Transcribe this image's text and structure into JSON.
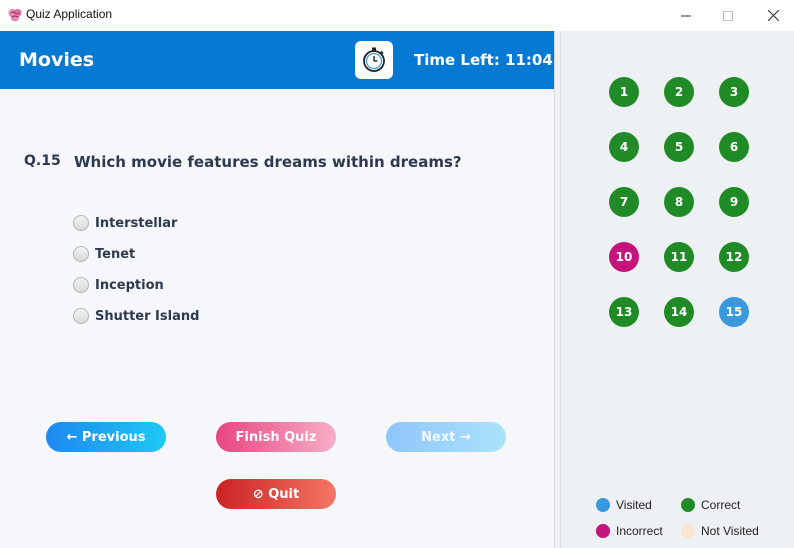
{
  "window": {
    "title": "Quiz Application"
  },
  "header": {
    "category": "Movies",
    "time_left": "Time Left: 11:04"
  },
  "question": {
    "number": "Q.15",
    "text": "Which movie features dreams within dreams?",
    "options": [
      "Interstellar",
      "Tenet",
      "Inception",
      "Shutter Island"
    ]
  },
  "buttons": {
    "previous": "← Previous",
    "finish": "Finish Quiz",
    "next": "Next →",
    "quit": "⊘ Quit"
  },
  "navigator": {
    "questions": [
      {
        "label": "1",
        "status": "correct"
      },
      {
        "label": "2",
        "status": "correct"
      },
      {
        "label": "3",
        "status": "correct"
      },
      {
        "label": "4",
        "status": "correct"
      },
      {
        "label": "5",
        "status": "correct"
      },
      {
        "label": "6",
        "status": "correct"
      },
      {
        "label": "7",
        "status": "correct"
      },
      {
        "label": "8",
        "status": "correct"
      },
      {
        "label": "9",
        "status": "correct"
      },
      {
        "label": "10",
        "status": "incorrect"
      },
      {
        "label": "11",
        "status": "correct"
      },
      {
        "label": "12",
        "status": "correct"
      },
      {
        "label": "13",
        "status": "correct"
      },
      {
        "label": "14",
        "status": "correct"
      },
      {
        "label": "15",
        "status": "visited"
      }
    ]
  },
  "legend": {
    "visited": "Visited",
    "correct": "Correct",
    "incorrect": "Incorrect",
    "not_visited": "Not Visited"
  },
  "colors": {
    "visited": "#3a98dc",
    "correct": "#1f8a26",
    "incorrect": "#c4157c",
    "not_visited": "#f7e6cf",
    "header": "#0679d3"
  }
}
